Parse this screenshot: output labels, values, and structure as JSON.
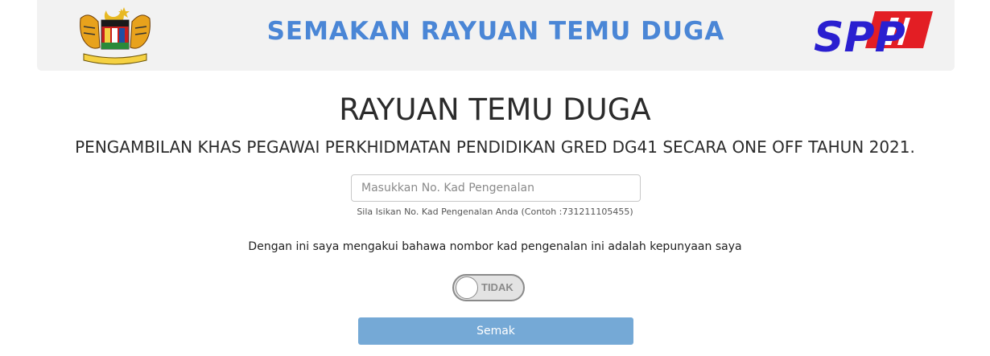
{
  "banner": {
    "title": "SEMAKAN RAYUAN TEMU DUGA",
    "left_logo_icon": "malaysia-coat-of-arms-icon",
    "right_logo_icon": "spp-logo-icon",
    "right_logo_text": "SPP",
    "title_color": "#4a86d6"
  },
  "main": {
    "title": "RAYUAN TEMU DUGA",
    "subtitle": "PENGAMBILAN KHAS PEGAWAI PERKHIDMATAN PENDIDIKAN GRED DG41 SECARA ONE OFF TAHUN 2021.",
    "ic_input": {
      "placeholder": "Masukkan No. Kad Pengenalan",
      "value": ""
    },
    "hint": "Sila Isikan No. Kad Pengenalan Anda (Contoh :731211105455)",
    "declaration": "Dengan ini saya mengakui bahawa nombor kad pengenalan ini adalah kepunyaan saya",
    "toggle": {
      "label": "TIDAK",
      "checked": false
    },
    "submit_label": "Semak",
    "button_color": "#75a9d6"
  }
}
